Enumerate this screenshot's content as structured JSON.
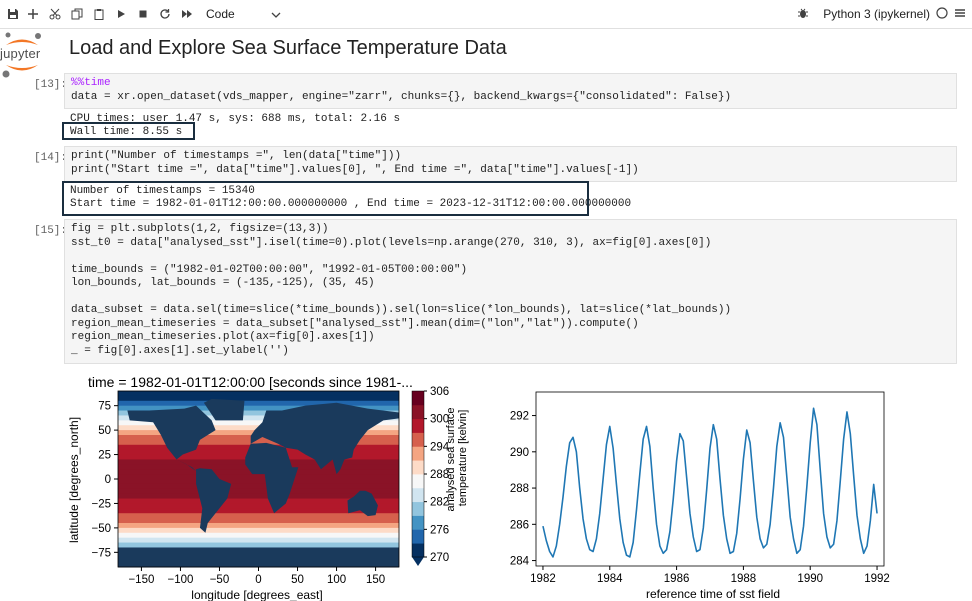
{
  "toolbar": {
    "cell_type": "Code",
    "kernel_name": "Python 3 (ipykernel)",
    "icons": [
      "save-icon",
      "add-icon",
      "cut-icon",
      "copy-icon",
      "paste-icon",
      "run-icon",
      "stop-icon",
      "restart-icon",
      "fast-forward-icon",
      "chevron-down-icon",
      "debug-icon",
      "kernel-status-icon",
      "menu-icon"
    ]
  },
  "logo_text": "jupyter",
  "title": "Load and Explore Sea Surface Temperature Data",
  "cells": [
    {
      "prompt": "[13]:",
      "lines": [
        "%%time",
        "data = xr.open_dataset(vds_mapper, engine=\"zarr\", chunks={}, backend_kwargs={\"consolidated\": False})"
      ],
      "output": [
        "CPU times: user 1.47 s, sys: 688 ms, total: 2.16 s",
        "Wall time: 8.55 s"
      ]
    },
    {
      "prompt": "[14]:",
      "lines": [
        "print(\"Number of timestamps =\", len(data[\"time\"]))",
        "print(\"Start time =\", data[\"time\"].values[0], \", End time =\", data[\"time\"].values[-1])"
      ],
      "output": [
        "Number of timestamps = 15340",
        "Start time = 1982-01-01T12:00:00.000000000 , End time = 2023-12-31T12:00:00.000000000"
      ]
    },
    {
      "prompt": "[15]:",
      "lines": [
        "fig = plt.subplots(1,2, figsize=(13,3))",
        "sst_t0 = data[\"analysed_sst\"].isel(time=0).plot(levels=np.arange(270, 310, 3), ax=fig[0].axes[0])",
        "",
        "time_bounds = (\"1982-01-02T00:00:00\", \"1992-01-05T00:00:00\")",
        "lon_bounds, lat_bounds = (-135,-125), (35, 45)",
        "",
        "data_subset = data.sel(time=slice(*time_bounds)).sel(lon=slice(*lon_bounds), lat=slice(*lat_bounds))",
        "region_mean_timeseries = data_subset[\"analysed_sst\"].mean(dim=(\"lon\",\"lat\")).compute()",
        "region_mean_timeseries.plot(ax=fig[0].axes[1])",
        "_ = fig[0].axes[1].set_ylabel('')"
      ]
    }
  ],
  "chart_data": [
    {
      "type": "heatmap",
      "title": "time = 1982-01-01T12:00:00 [seconds since 1981-...",
      "xlabel": "longitude [degrees_east]",
      "ylabel": "latitude [degrees_north]",
      "xlim": [
        -180,
        180
      ],
      "ylim": [
        -90,
        90
      ],
      "xticks": [
        -150,
        -100,
        -50,
        0,
        50,
        100,
        150
      ],
      "yticks": [
        75,
        50,
        25,
        0,
        -25,
        -50,
        -75
      ],
      "colorbar": {
        "label": "analysed sea surface temperature [kelvin]",
        "ticks": [
          306,
          300,
          294,
          288,
          282,
          276,
          270
        ],
        "levels": [
          270,
          273,
          276,
          279,
          282,
          285,
          288,
          291,
          294,
          297,
          300,
          303,
          306
        ],
        "colormap": "RdBu_r"
      },
      "land_color": "#1a3a5c"
    },
    {
      "type": "line",
      "xlabel": "reference time of sst field",
      "ylabel": "",
      "xlim": [
        1982,
        1992
      ],
      "ylim": [
        283.7,
        293.3
      ],
      "xticks": [
        1982,
        1984,
        1986,
        1988,
        1990,
        1992
      ],
      "yticks": [
        284,
        286,
        288,
        290,
        292
      ],
      "color": "#1f77b4",
      "series": [
        {
          "x": [
            1982.0,
            1982.1,
            1982.2,
            1982.3,
            1982.4,
            1982.5,
            1982.6,
            1982.7,
            1982.8,
            1982.9,
            1983.0,
            1983.1,
            1983.2,
            1983.3,
            1983.4,
            1983.5,
            1983.6,
            1983.7,
            1983.8,
            1983.9,
            1984.0,
            1984.1,
            1984.2,
            1984.3,
            1984.4,
            1984.5,
            1984.6,
            1984.7,
            1984.8,
            1984.9,
            1985.0,
            1985.1,
            1985.2,
            1985.3,
            1985.4,
            1985.5,
            1985.6,
            1985.7,
            1985.8,
            1985.9,
            1986.0,
            1986.1,
            1986.2,
            1986.3,
            1986.4,
            1986.5,
            1986.6,
            1986.7,
            1986.8,
            1986.9,
            1987.0,
            1987.1,
            1987.2,
            1987.3,
            1987.4,
            1987.5,
            1987.6,
            1987.7,
            1987.8,
            1987.9,
            1988.0,
            1988.1,
            1988.2,
            1988.3,
            1988.4,
            1988.5,
            1988.6,
            1988.7,
            1988.8,
            1988.9,
            1989.0,
            1989.1,
            1989.2,
            1989.3,
            1989.4,
            1989.5,
            1989.6,
            1989.7,
            1989.8,
            1989.9,
            1990.0,
            1990.1,
            1990.2,
            1990.3,
            1990.4,
            1990.5,
            1990.6,
            1990.7,
            1990.8,
            1990.9,
            1991.0,
            1991.1,
            1991.2,
            1991.3,
            1991.4,
            1991.5,
            1991.6,
            1991.7,
            1991.8,
            1991.9,
            1992.0
          ],
          "values": [
            285.9,
            285.1,
            284.5,
            284.2,
            284.8,
            286.0,
            287.5,
            289.2,
            290.5,
            290.8,
            290.0,
            288.0,
            286.3,
            285.2,
            284.6,
            284.5,
            285.2,
            286.6,
            288.5,
            290.4,
            291.4,
            290.2,
            288.2,
            286.3,
            285.0,
            284.3,
            284.2,
            285.0,
            286.8,
            288.8,
            290.7,
            291.4,
            290.3,
            288.0,
            286.0,
            284.8,
            284.4,
            284.6,
            285.6,
            287.4,
            289.5,
            291.0,
            290.6,
            288.6,
            286.6,
            285.3,
            284.5,
            284.6,
            285.8,
            287.9,
            290.2,
            291.5,
            290.7,
            288.5,
            286.5,
            285.2,
            284.4,
            284.5,
            285.5,
            287.4,
            289.6,
            291.2,
            290.5,
            288.4,
            286.4,
            285.2,
            284.7,
            284.9,
            286.0,
            288.0,
            290.3,
            291.6,
            290.8,
            288.6,
            286.4,
            285.2,
            284.4,
            284.6,
            285.9,
            288.1,
            290.5,
            292.4,
            291.5,
            289.0,
            286.6,
            285.3,
            284.7,
            284.9,
            286.2,
            288.4,
            290.7,
            292.2,
            291.0,
            288.7,
            286.5,
            285.2,
            284.4,
            284.8,
            286.2,
            288.2,
            286.6
          ]
        }
      ]
    }
  ]
}
